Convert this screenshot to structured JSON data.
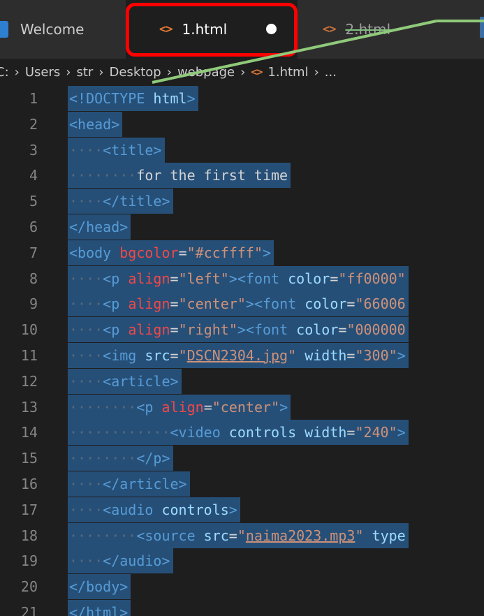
{
  "tabs": [
    {
      "label": "Welcome"
    },
    {
      "label": "1.html"
    },
    {
      "label": "2.html"
    }
  ],
  "breadcrumb": [
    "C:",
    "Users",
    "str",
    "Desktop",
    "webpage",
    "1.html",
    "..."
  ],
  "code_lines": [
    {
      "n": "1",
      "indent": "",
      "segs": [
        [
          "t-tag",
          "<!DOCTYPE"
        ],
        [
          "t-txt",
          " "
        ],
        [
          "t-attr",
          "html"
        ],
        [
          "t-tag",
          ">"
        ]
      ]
    },
    {
      "n": "2",
      "indent": "",
      "segs": [
        [
          "t-tag",
          "<head>"
        ]
      ]
    },
    {
      "n": "3",
      "indent": "····",
      "segs": [
        [
          "t-tag",
          "<title>"
        ]
      ]
    },
    {
      "n": "4",
      "indent": "········",
      "segs": [
        [
          "t-txt",
          "for the first time"
        ]
      ]
    },
    {
      "n": "5",
      "indent": "····",
      "segs": [
        [
          "t-tag",
          "</title>"
        ]
      ]
    },
    {
      "n": "6",
      "indent": "",
      "segs": [
        [
          "t-tag",
          "</head>"
        ]
      ]
    },
    {
      "n": "7",
      "indent": "",
      "segs": [
        [
          "t-tag",
          "<body"
        ],
        [
          "t-txt",
          " "
        ],
        [
          "t-err",
          "bgcolor"
        ],
        [
          "t-txt",
          "="
        ],
        [
          "t-str",
          "\"#ccffff\""
        ],
        [
          "t-tag",
          ">"
        ]
      ]
    },
    {
      "n": "8",
      "indent": "····",
      "segs": [
        [
          "t-tag",
          "<p"
        ],
        [
          "t-txt",
          " "
        ],
        [
          "t-err",
          "align"
        ],
        [
          "t-txt",
          "="
        ],
        [
          "t-str",
          "\"left\""
        ],
        [
          "t-tag",
          "><font"
        ],
        [
          "t-txt",
          " "
        ],
        [
          "t-attr",
          "color"
        ],
        [
          "t-txt",
          "="
        ],
        [
          "t-str",
          "\"ff0000\""
        ]
      ]
    },
    {
      "n": "9",
      "indent": "····",
      "segs": [
        [
          "t-tag",
          "<p"
        ],
        [
          "t-txt",
          " "
        ],
        [
          "t-err",
          "align"
        ],
        [
          "t-txt",
          "="
        ],
        [
          "t-str",
          "\"center\""
        ],
        [
          "t-tag",
          "><font"
        ],
        [
          "t-txt",
          " "
        ],
        [
          "t-attr",
          "color"
        ],
        [
          "t-txt",
          "="
        ],
        [
          "t-str",
          "\"66006"
        ]
      ]
    },
    {
      "n": "10",
      "indent": "····",
      "segs": [
        [
          "t-tag",
          "<p"
        ],
        [
          "t-txt",
          " "
        ],
        [
          "t-err",
          "align"
        ],
        [
          "t-txt",
          "="
        ],
        [
          "t-str",
          "\"right\""
        ],
        [
          "t-tag",
          "><font"
        ],
        [
          "t-txt",
          " "
        ],
        [
          "t-attr",
          "color"
        ],
        [
          "t-txt",
          "="
        ],
        [
          "t-str",
          "\"000000"
        ]
      ]
    },
    {
      "n": "11",
      "indent": "····",
      "segs": [
        [
          "t-tag",
          "<img"
        ],
        [
          "t-txt",
          " "
        ],
        [
          "t-attr",
          "src"
        ],
        [
          "t-txt",
          "="
        ],
        [
          "t-str",
          "\""
        ],
        [
          "t-link",
          "DSCN2304.jpg"
        ],
        [
          "t-str",
          "\""
        ],
        [
          "t-txt",
          " "
        ],
        [
          "t-attr",
          "width"
        ],
        [
          "t-txt",
          "="
        ],
        [
          "t-str",
          "\"300\""
        ],
        [
          "t-tag",
          ">"
        ]
      ]
    },
    {
      "n": "12",
      "indent": "····",
      "segs": [
        [
          "t-tag",
          "<article>"
        ]
      ]
    },
    {
      "n": "13",
      "indent": "········",
      "segs": [
        [
          "t-tag",
          "<p"
        ],
        [
          "t-txt",
          " "
        ],
        [
          "t-err",
          "align"
        ],
        [
          "t-txt",
          "="
        ],
        [
          "t-str",
          "\"center\""
        ],
        [
          "t-tag",
          ">"
        ]
      ]
    },
    {
      "n": "14",
      "indent": "············",
      "segs": [
        [
          "t-tag",
          "<video"
        ],
        [
          "t-txt",
          " "
        ],
        [
          "t-attr",
          "controls"
        ],
        [
          "t-txt",
          " "
        ],
        [
          "t-attr",
          "width"
        ],
        [
          "t-txt",
          "="
        ],
        [
          "t-str",
          "\"240\""
        ],
        [
          "t-tag",
          ">"
        ]
      ]
    },
    {
      "n": "15",
      "indent": "········",
      "segs": [
        [
          "t-tag",
          "</p>"
        ]
      ]
    },
    {
      "n": "16",
      "indent": "····",
      "segs": [
        [
          "t-tag",
          "</article>"
        ]
      ]
    },
    {
      "n": "17",
      "indent": "····",
      "segs": [
        [
          "t-tag",
          "<audio"
        ],
        [
          "t-txt",
          " "
        ],
        [
          "t-attr",
          "controls"
        ],
        [
          "t-tag",
          ">"
        ]
      ]
    },
    {
      "n": "18",
      "indent": "········",
      "segs": [
        [
          "t-tag",
          "<source"
        ],
        [
          "t-txt",
          " "
        ],
        [
          "t-attr",
          "src"
        ],
        [
          "t-txt",
          "="
        ],
        [
          "t-str",
          "\""
        ],
        [
          "t-link",
          "naima2023.mp3"
        ],
        [
          "t-str",
          "\""
        ],
        [
          "t-txt",
          " "
        ],
        [
          "t-attr",
          "type"
        ]
      ]
    },
    {
      "n": "19",
      "indent": "····",
      "segs": [
        [
          "t-tag",
          "</audio>"
        ]
      ]
    },
    {
      "n": "20",
      "indent": "",
      "segs": [
        [
          "t-tag",
          "</body>"
        ]
      ]
    },
    {
      "n": "21",
      "indent": "",
      "segs": [
        [
          "t-tag",
          "</html>"
        ]
      ]
    }
  ],
  "colors": {
    "highlight_box": "#ff0000",
    "annotation_line": "#8fca7a",
    "selection": "#264f78",
    "tag": "#569cd6",
    "attribute": "#9cdcfe",
    "string": "#ce9178"
  },
  "icons": {
    "tab_file_icon": "html-file-icon",
    "modified_indicator": "dirty-dot-icon"
  }
}
